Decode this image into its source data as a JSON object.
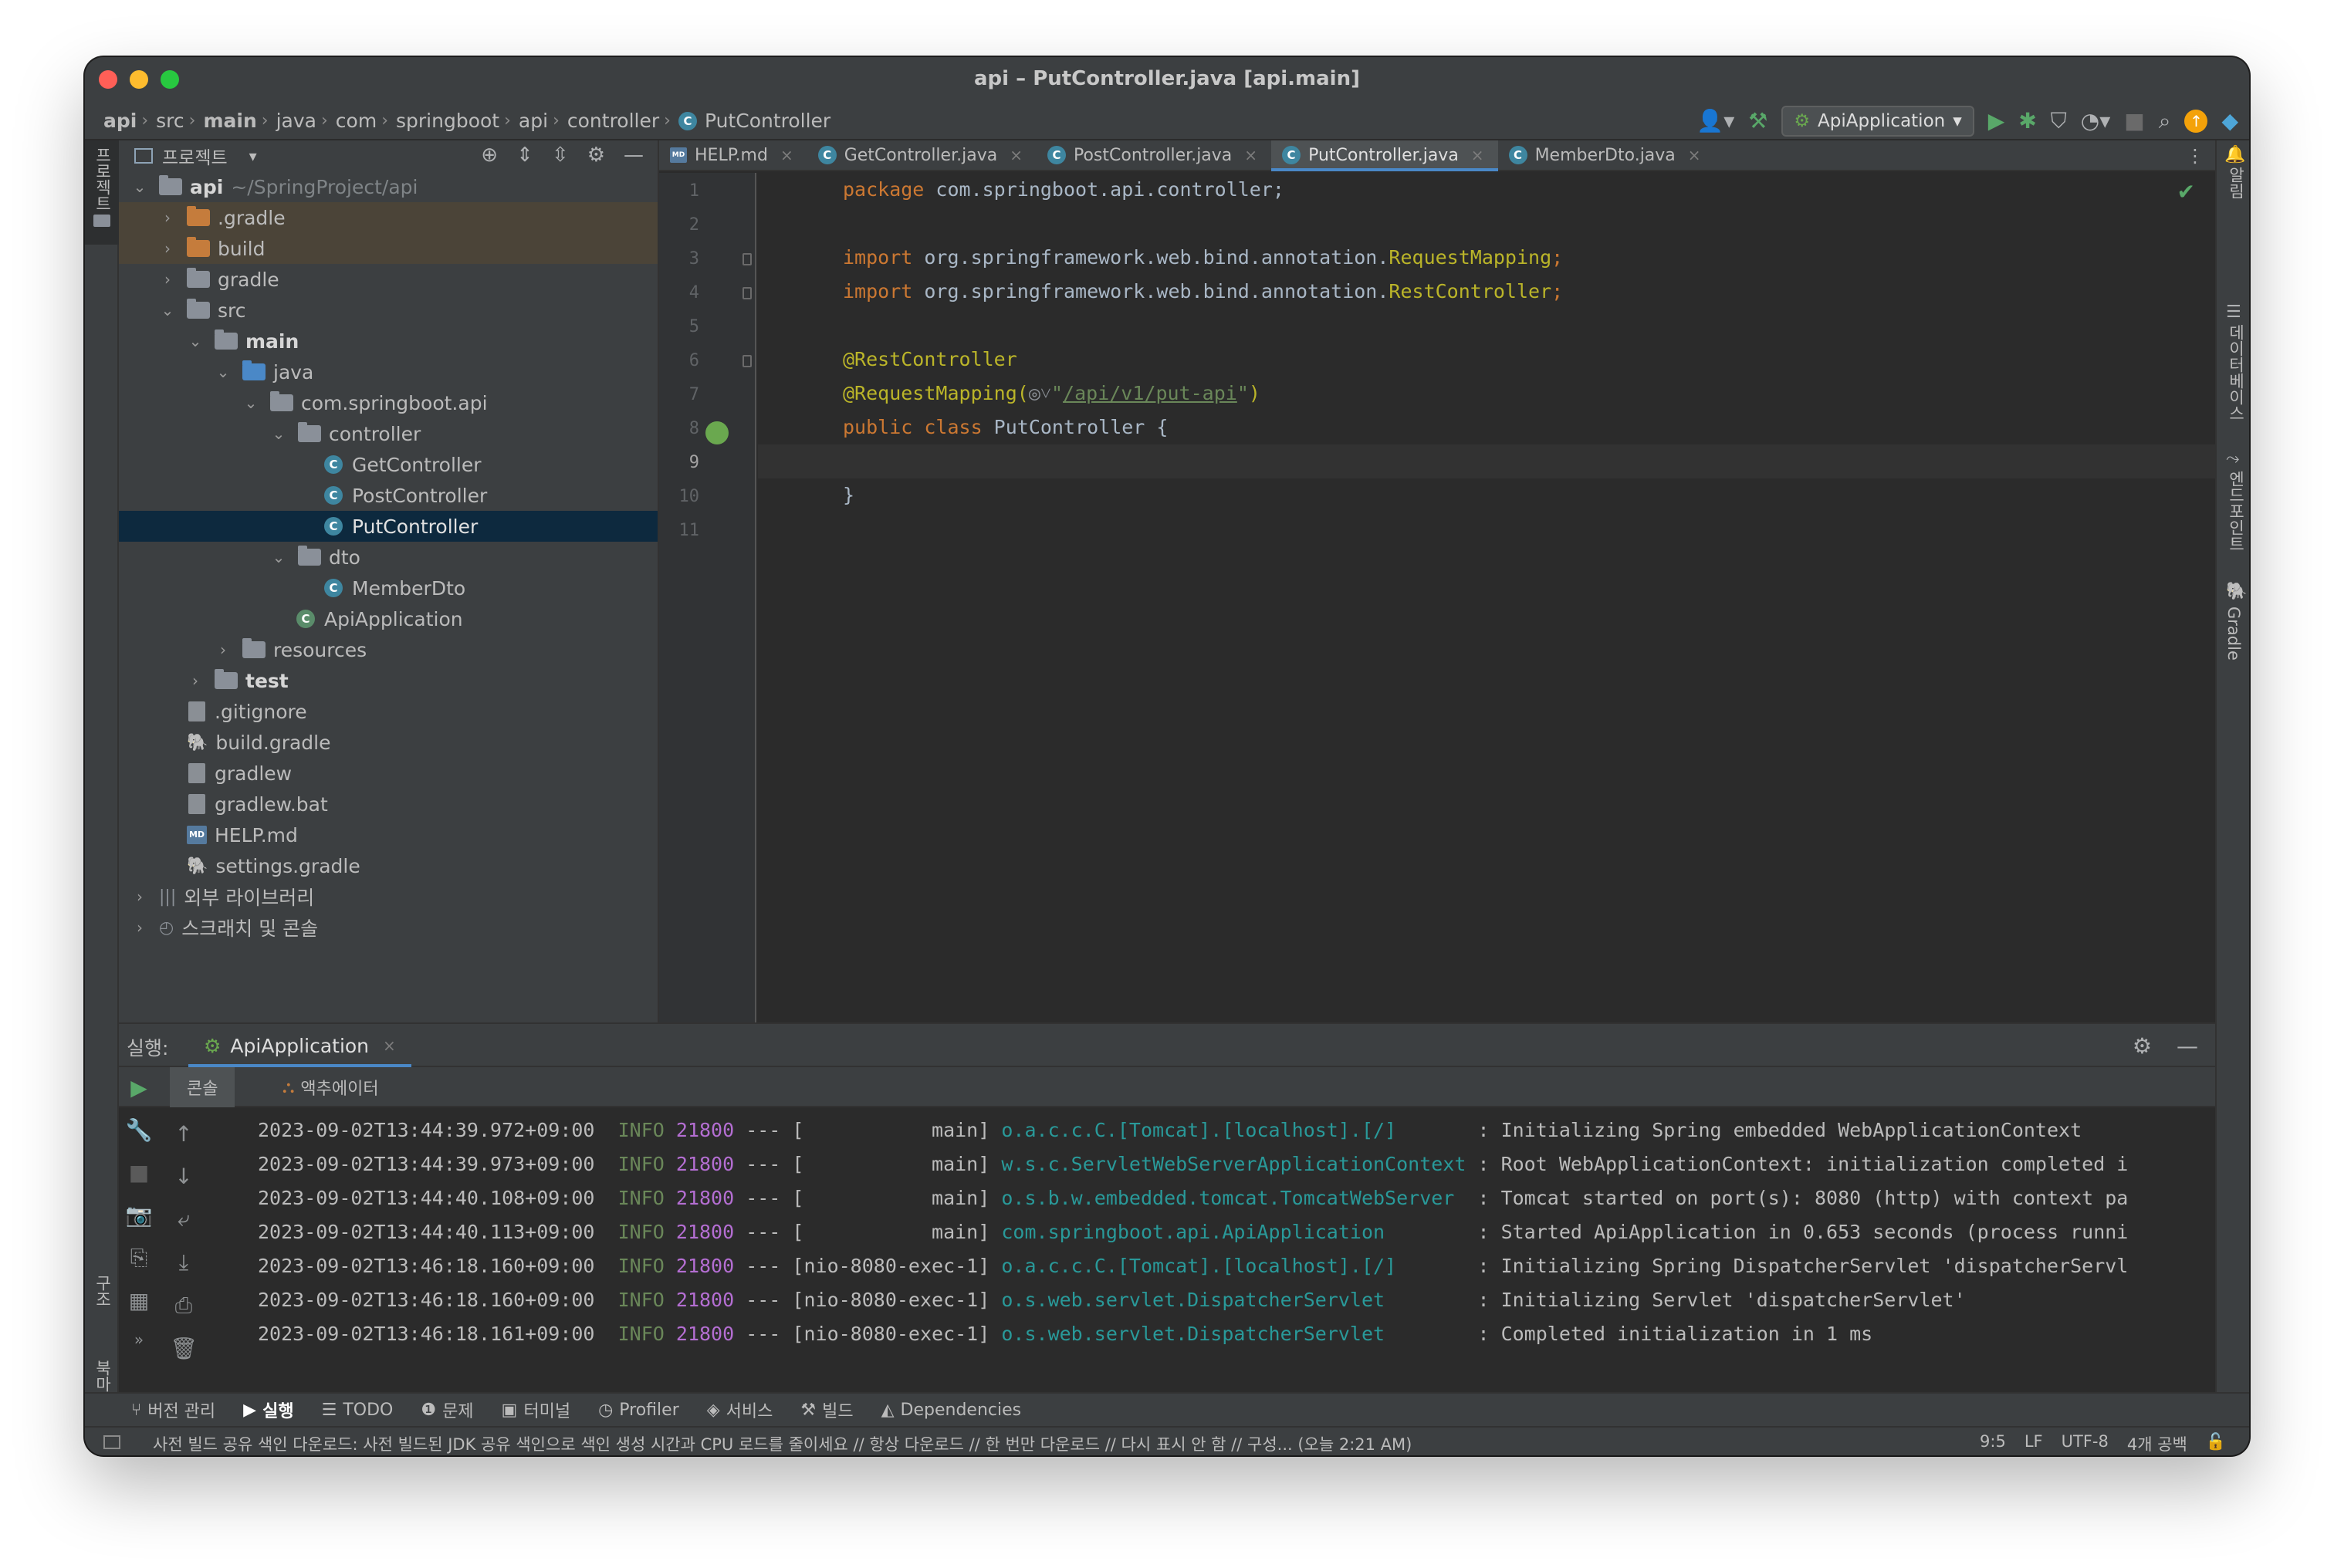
{
  "window": {
    "title": "api – PutController.java [api.main]"
  },
  "breadcrumb": [
    "api",
    "src",
    "main",
    "java",
    "com",
    "springboot",
    "api",
    "controller",
    "PutController"
  ],
  "toolbar": {
    "run_config": "ApiApplication"
  },
  "left_strip": {
    "project": "프로젝트",
    "structure": "구조",
    "bookmarks": "북마크"
  },
  "right_strip": {
    "notifications": "알림",
    "database": "데이터베이스",
    "endpoints": "엔드포인트",
    "gradle": "Gradle"
  },
  "project_panel": {
    "title": "프로젝트",
    "tree": [
      {
        "label": "api",
        "extra": "~/SpringProject/api"
      },
      {
        "label": ".gradle"
      },
      {
        "label": "build"
      },
      {
        "label": "gradle"
      },
      {
        "label": "src"
      },
      {
        "label": "main"
      },
      {
        "label": "java"
      },
      {
        "label": "com.springboot.api"
      },
      {
        "label": "controller"
      },
      {
        "label": "GetController"
      },
      {
        "label": "PostController"
      },
      {
        "label": "PutController"
      },
      {
        "label": "dto"
      },
      {
        "label": "MemberDto"
      },
      {
        "label": "ApiApplication"
      },
      {
        "label": "resources"
      },
      {
        "label": "test"
      },
      {
        "label": ".gitignore"
      },
      {
        "label": "build.gradle"
      },
      {
        "label": "gradlew"
      },
      {
        "label": "gradlew.bat"
      },
      {
        "label": "HELP.md"
      },
      {
        "label": "settings.gradle"
      },
      {
        "label": "외부 라이브러리"
      },
      {
        "label": "스크래치 및 콘솔"
      }
    ]
  },
  "editor": {
    "tabs": [
      "HELP.md",
      "GetController.java",
      "PostController.java",
      "PutController.java",
      "MemberDto.java"
    ],
    "active_tab": "PutController.java",
    "line_numbers": [
      "1",
      "2",
      "3",
      "4",
      "5",
      "6",
      "7",
      "8",
      "9",
      "10",
      "11"
    ],
    "code": {
      "pkg_kw": "package",
      "pkg_name": " com.springboot.api.controller;",
      "import1_kw": "import",
      "import1_path": " org.springframework.web.bind.annotation.",
      "import1_cls": "RequestMapping",
      "import1_end": ";",
      "import2_kw": "import",
      "import2_path": " org.springframework.web.bind.annotation.",
      "import2_cls": "RestController",
      "import2_end": ";",
      "ann1": "@RestController",
      "ann2": "@RequestMapping(",
      "ann2_glyph": "◎˅",
      "ann2_q1": "\"",
      "ann2_url": "/api/v1/put-api",
      "ann2_q2": "\"",
      "ann2_close": ")",
      "class_kw": "public class",
      "class_name": " PutController {",
      "close_brace": "}"
    }
  },
  "run_panel": {
    "label": "실행:",
    "tab": "ApiApplication",
    "console_tab": "콘솔",
    "actuator_tab": "액추에이터",
    "logs": [
      {
        "ts": "2023-09-02T13:44:39.972+09:00",
        "level": "INFO",
        "pid": "21800",
        "sep": " --- [",
        "thread": "           main]",
        "logger": "o.a.c.c.C.[Tomcat].[localhost].[/]      ",
        "msg": " : Initializing Spring embedded WebApplicationContext"
      },
      {
        "ts": "2023-09-02T13:44:39.973+09:00",
        "level": "INFO",
        "pid": "21800",
        "sep": " --- [",
        "thread": "           main]",
        "logger": "w.s.c.ServletWebServerApplicationContext",
        "msg": " : Root WebApplicationContext: initialization completed i"
      },
      {
        "ts": "2023-09-02T13:44:40.108+09:00",
        "level": "INFO",
        "pid": "21800",
        "sep": " --- [",
        "thread": "           main]",
        "logger": "o.s.b.w.embedded.tomcat.TomcatWebServer ",
        "msg": " : Tomcat started on port(s): 8080 (http) with context pa"
      },
      {
        "ts": "2023-09-02T13:44:40.113+09:00",
        "level": "INFO",
        "pid": "21800",
        "sep": " --- [",
        "thread": "           main]",
        "logger": "com.springboot.api.ApiApplication       ",
        "msg": " : Started ApiApplication in 0.653 seconds (process runni"
      },
      {
        "ts": "2023-09-02T13:46:18.160+09:00",
        "level": "INFO",
        "pid": "21800",
        "sep": " --- [",
        "thread": "nio-8080-exec-1]",
        "logger": "o.a.c.c.C.[Tomcat].[localhost].[/]      ",
        "msg": " : Initializing Spring DispatcherServlet 'dispatcherServl"
      },
      {
        "ts": "2023-09-02T13:46:18.160+09:00",
        "level": "INFO",
        "pid": "21800",
        "sep": " --- [",
        "thread": "nio-8080-exec-1]",
        "logger": "o.s.web.servlet.DispatcherServlet       ",
        "msg": " : Initializing Servlet 'dispatcherServlet'"
      },
      {
        "ts": "2023-09-02T13:46:18.161+09:00",
        "level": "INFO",
        "pid": "21800",
        "sep": " --- [",
        "thread": "nio-8080-exec-1]",
        "logger": "o.s.web.servlet.DispatcherServlet       ",
        "msg": " : Completed initialization in 1 ms"
      }
    ]
  },
  "tool_tabs": [
    "버전 관리",
    "실행",
    "TODO",
    "문제",
    "터미널",
    "Profiler",
    "서비스",
    "빌드",
    "Dependencies"
  ],
  "status_bar": {
    "message": "사전 빌드 공유 색인 다운로드: 사전 빌드된 JDK 공유 색인으로 색인 생성 시간과 CPU 로드를 줄이세요 // 항상 다운로드 // 한 번만 다운로드 // 다시 표시 안 함 // 구성... (오늘 2:21 AM)",
    "position": "9:5",
    "line_sep": "LF",
    "encoding": "UTF-8",
    "indent": "4개 공백"
  }
}
